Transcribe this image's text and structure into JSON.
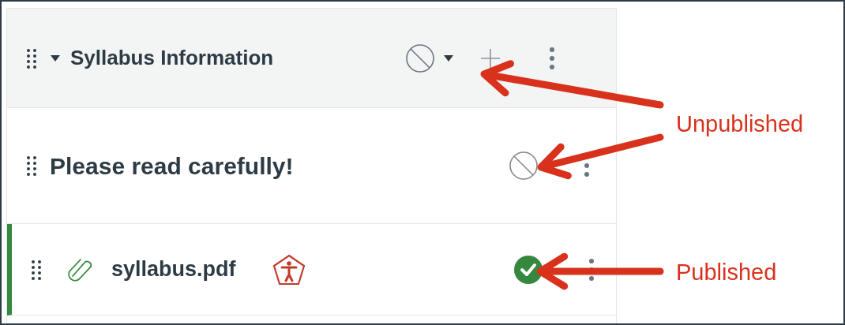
{
  "module": {
    "title": "Syllabus Information",
    "published": false,
    "expanded": true
  },
  "items": [
    {
      "kind": "text_header",
      "title": "Please read carefully!",
      "published": false
    },
    {
      "kind": "file",
      "title": "syllabus.pdf",
      "published": true,
      "accessibility_issue": true
    }
  ],
  "annotations": [
    {
      "label": "Unpublished"
    },
    {
      "label": "Published"
    }
  ]
}
